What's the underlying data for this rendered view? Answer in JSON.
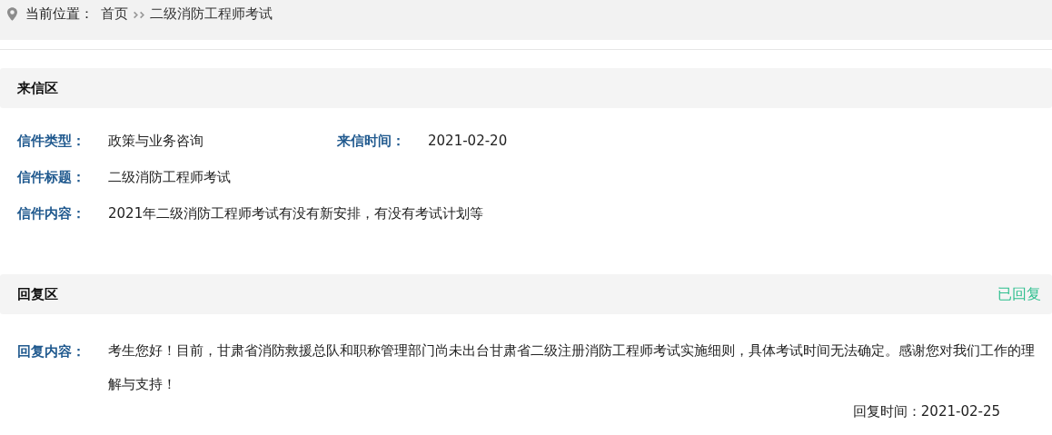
{
  "breadcrumb": {
    "label": "当前位置：",
    "items": [
      "首页",
      "二级消防工程师考试"
    ]
  },
  "letter": {
    "title": "来信区",
    "fields": [
      {
        "label": "信件类型：",
        "value": "政策与业务咨询"
      },
      {
        "label": "来信时间：",
        "value": "2021-02-20"
      },
      {
        "label": "信件标题：",
        "value": "二级消防工程师考试"
      },
      {
        "label": "信件内容：",
        "value": "2021年二级消防工程师考试有没有新安排，有没有考试计划等"
      }
    ]
  },
  "reply": {
    "title": "回复区",
    "status": "已回复",
    "label": "回复内容：",
    "content": "考生您好！目前，甘肃省消防救援总队和职称管理部门尚未出台甘肃省二级注册消防工程师考试实施细则，具体考试时间无法确定。感谢您对我们工作的理解与支持！",
    "time_label": "回复时间：",
    "time": "2021-02-25"
  }
}
